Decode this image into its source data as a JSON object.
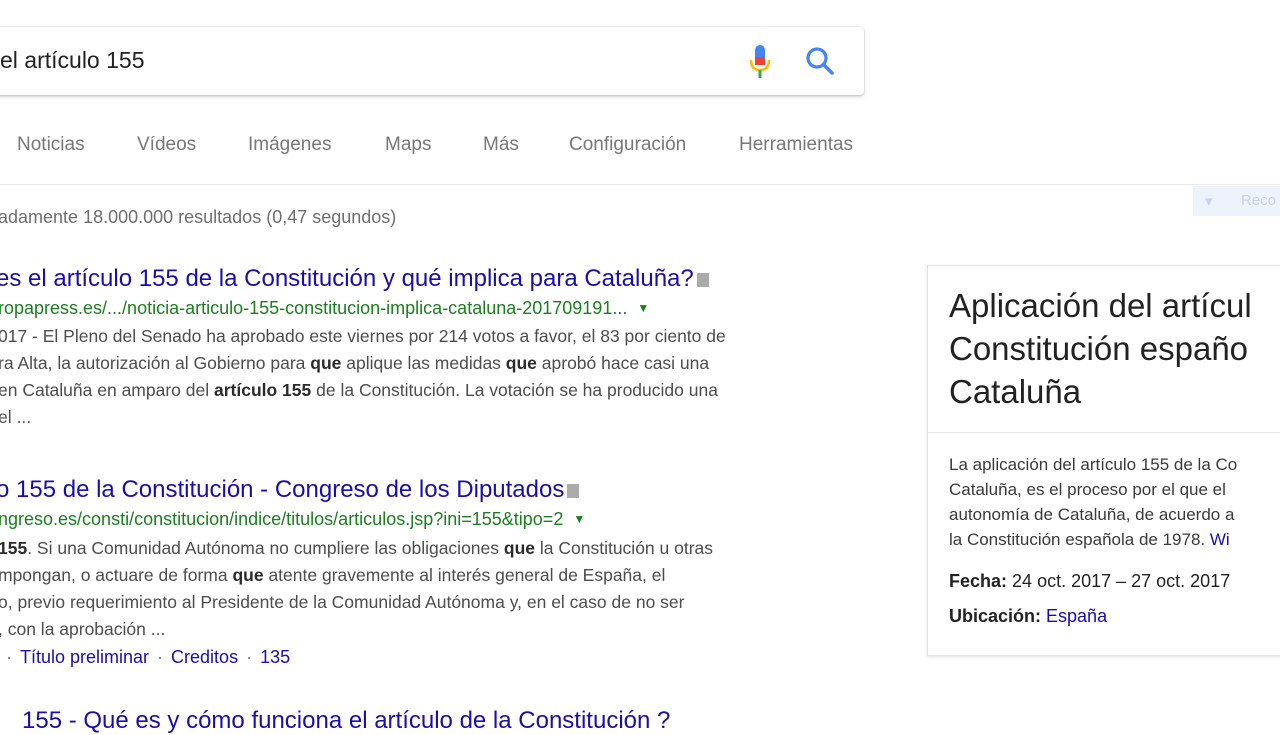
{
  "search": {
    "query": "el artículo 155"
  },
  "tabs": [
    {
      "label": "Noticias"
    },
    {
      "label": "Vídeos"
    },
    {
      "label": "Imágenes"
    },
    {
      "label": "Maps"
    },
    {
      "label": "Más"
    },
    {
      "label": "Configuración"
    },
    {
      "label": "Herramientas"
    }
  ],
  "stats": "adamente 18.000.000 resultados (0,47 segundos)",
  "faded_button": {
    "label": "Reco"
  },
  "results": [
    {
      "title": "es el artículo 155 de la Constitución y qué implica para Cataluña?",
      "url": "ropapress.es/.../noticia-articulo-155-constitucion-implica-cataluna-201709191...",
      "snippet": [
        [
          {
            "t": "017 - El Pleno del Senado ha aprobado este viernes por 214 votos a favor, el 83 por ciento de"
          }
        ],
        [
          {
            "t": "ra Alta, la autorización al Gobierno para "
          },
          {
            "b": "que"
          },
          {
            "t": " aplique las medidas "
          },
          {
            "b": "que"
          },
          {
            "t": " aprobó hace casi una"
          }
        ],
        [
          {
            "t": "en Cataluña en amparo del "
          },
          {
            "b": "artículo 155"
          },
          {
            "t": " de la Constitución. La votación se ha producido una"
          }
        ],
        [
          {
            "t": "el ..."
          }
        ]
      ]
    },
    {
      "title": "o 155 de la Constitución - Congreso de los Diputados",
      "url": "ngreso.es/consti/constitucion/indice/titulos/articulos.jsp?ini=155&tipo=2",
      "snippet": [
        [
          {
            "b": "155"
          },
          {
            "t": ". Si una Comunidad Autónoma no cumpliere las obligaciones "
          },
          {
            "b": "que"
          },
          {
            "t": " la Constitución u otras"
          }
        ],
        [
          {
            "t": "mpongan, o actuare de forma "
          },
          {
            "b": "que"
          },
          {
            "t": " atente gravemente al interés general de España, el"
          }
        ],
        [
          {
            "t": "o, previo requerimiento al Presidente de la Comunidad Autónoma y, en el caso de no ser"
          }
        ],
        [
          {
            "t": ", con la aprobación ..."
          }
        ]
      ],
      "sublinks": [
        "Título preliminar",
        "Creditos",
        "135"
      ]
    }
  ],
  "partial_result_title": "155 - Qué es y cómo funciona el artículo de la Constitución ?",
  "knowledge_panel": {
    "title_lines": [
      "Aplicación del artícul",
      "Constitución españo",
      "Cataluña"
    ],
    "desc_lines": [
      "La aplicación del artículo 155 de la Co",
      "Cataluña, es el proceso por el que el",
      "autonomía de Cataluña, de acuerdo a",
      "la Constitución española de 1978."
    ],
    "wiki_link": "Wi",
    "fecha_label": "Fecha:",
    "fecha_value": "24 oct. 2017 – 27 oct. 2017",
    "ubicacion_label": "Ubicación:",
    "ubicacion_value": "España"
  },
  "colors": {
    "link": "#1a0dab",
    "url": "#1a7f1e",
    "mic_blue": "#4285f4",
    "mic_red": "#ea4335",
    "mic_yellow": "#fbbc05",
    "mic_green": "#34a853"
  },
  "icons": {
    "mic": "microphone-icon",
    "search": "search-icon",
    "caret": "caret-down-icon",
    "cache": "cached-page-icon"
  }
}
